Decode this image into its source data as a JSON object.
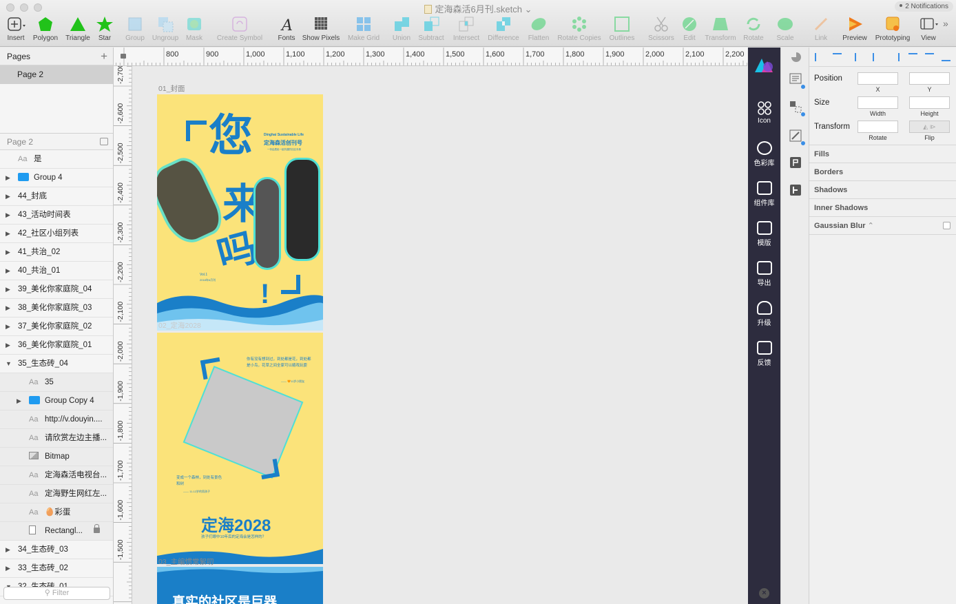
{
  "window": {
    "title": "定海森活6月刊.sketch",
    "notifications": "2 Notifications"
  },
  "toolbar": {
    "items": [
      {
        "label": "Insert",
        "icon": "insert-plus-icon"
      },
      {
        "label": "Polygon",
        "icon": "polygon-icon"
      },
      {
        "label": "Triangle",
        "icon": "triangle-icon"
      },
      {
        "label": "Star",
        "icon": "star-icon"
      },
      {
        "label": "Group",
        "icon": "group-icon"
      },
      {
        "label": "Ungroup",
        "icon": "ungroup-icon"
      },
      {
        "label": "Mask",
        "icon": "mask-icon"
      },
      {
        "label": "Create Symbol",
        "icon": "create-symbol-icon"
      },
      {
        "label": "Fonts",
        "icon": "fonts-icon"
      },
      {
        "label": "Show Pixels",
        "icon": "show-pixels-icon"
      },
      {
        "label": "Make Grid",
        "icon": "make-grid-icon"
      },
      {
        "label": "Union",
        "icon": "union-icon"
      },
      {
        "label": "Subtract",
        "icon": "subtract-icon"
      },
      {
        "label": "Intersect",
        "icon": "intersect-icon"
      },
      {
        "label": "Difference",
        "icon": "difference-icon"
      },
      {
        "label": "Flatten",
        "icon": "flatten-icon"
      },
      {
        "label": "Rotate Copies",
        "icon": "rotate-copies-icon"
      },
      {
        "label": "Outlines",
        "icon": "outlines-icon"
      },
      {
        "label": "Scissors",
        "icon": "scissors-icon"
      },
      {
        "label": "Edit",
        "icon": "edit-icon"
      },
      {
        "label": "Transform",
        "icon": "transform-icon"
      },
      {
        "label": "Rotate",
        "icon": "rotate-icon"
      },
      {
        "label": "Scale",
        "icon": "scale-icon"
      },
      {
        "label": "Link",
        "icon": "link-icon"
      },
      {
        "label": "Preview",
        "icon": "preview-icon"
      },
      {
        "label": "Prototyping",
        "icon": "prototyping-icon"
      },
      {
        "label": "View",
        "icon": "view-icon"
      }
    ]
  },
  "sidebar": {
    "pages_title": "Pages",
    "current_page": "Page 2",
    "layers_title": "Page 2",
    "filter_placeholder": "Filter",
    "layers": [
      {
        "name": "是",
        "kind": "text",
        "level": 0
      },
      {
        "name": "Group 4",
        "kind": "group",
        "level": 0
      },
      {
        "name": "44_封底",
        "kind": "artboard",
        "level": 0
      },
      {
        "name": "43_活动时间表",
        "kind": "artboard",
        "level": 0
      },
      {
        "name": "42_社区小组列表",
        "kind": "artboard",
        "level": 0
      },
      {
        "name": "41_共治_02",
        "kind": "artboard",
        "level": 0
      },
      {
        "name": "40_共治_01",
        "kind": "artboard",
        "level": 0
      },
      {
        "name": "39_美化你家庭院_04",
        "kind": "artboard",
        "level": 0
      },
      {
        "name": "38_美化你家庭院_03",
        "kind": "artboard",
        "level": 0
      },
      {
        "name": "37_美化你家庭院_02",
        "kind": "artboard",
        "level": 0
      },
      {
        "name": "36_美化你家庭院_01",
        "kind": "artboard",
        "level": 0
      },
      {
        "name": "35_生态砖_04",
        "kind": "artboard-open",
        "level": 0
      },
      {
        "name": "35",
        "kind": "text",
        "level": 1
      },
      {
        "name": "Group Copy 4",
        "kind": "group",
        "level": 1
      },
      {
        "name": "http://v.douyin....",
        "kind": "text",
        "level": 1
      },
      {
        "name": "请欣赏左边主播...",
        "kind": "text",
        "level": 1
      },
      {
        "name": "Bitmap",
        "kind": "bitmap",
        "level": 1
      },
      {
        "name": "定海森活电视台...",
        "kind": "text",
        "level": 1
      },
      {
        "name": "定海野生网红左...",
        "kind": "text",
        "level": 1
      },
      {
        "name": "🥚彩蛋",
        "kind": "text",
        "level": 1
      },
      {
        "name": "Rectangl...",
        "kind": "rect-locked",
        "level": 1
      },
      {
        "name": "34_生态砖_03",
        "kind": "artboard",
        "level": 0
      },
      {
        "name": "33_生态砖_02",
        "kind": "artboard",
        "level": 0
      },
      {
        "name": "32_生态砖_01",
        "kind": "artboard-open",
        "level": 0
      }
    ]
  },
  "rulers": {
    "top": [
      "800",
      "900",
      "1,000",
      "1,100",
      "1,200",
      "1,300",
      "1,400",
      "1,500",
      "1,600",
      "1,700",
      "1,800",
      "1,900",
      "2,000",
      "2,100",
      "2,200"
    ],
    "left": [
      "-2,700",
      "-2,600",
      "-2,500",
      "-2,400",
      "-2,300",
      "-2,200",
      "-2,100",
      "-2,000",
      "-1,900",
      "-1,800",
      "-1,700",
      "-1,600",
      "-1,500"
    ]
  },
  "canvas": {
    "artboards": [
      {
        "label": "01_封面"
      },
      {
        "label": "02_定海2028"
      },
      {
        "label": "03_主编惯常絮叨"
      }
    ],
    "cover": {
      "subtitle_en": "Dinghai Sustainable Life",
      "title_cn": "定海森活创刊号",
      "tagline": "一份由居民一起共建的社区手册",
      "headline_chars": [
        "您",
        "来",
        "吗",
        "!"
      ],
      "vol": "Vol.1",
      "date": "2018年6月刊"
    },
    "page2": {
      "quote_top": "你有没有想到过，到处都是花，到处都是小鸟，花草之间全家可以嬉戏玩耍",
      "quote_top_author": "—— 🧡11岁小朋友",
      "quote_bottom": "变成一个森林，到处有景色和树",
      "quote_bottom_author": "—— 11-12岁的男孩子",
      "headline": "定海2028",
      "subline": "孩子们眼中10年后的定海会是怎样的？"
    },
    "page3": {
      "headline": "真实的社区是巨器"
    }
  },
  "plugin_panel": {
    "items": [
      {
        "label": "Icon",
        "icon": "icon-grid-icon"
      },
      {
        "label": "色彩库",
        "icon": "palette-icon"
      },
      {
        "label": "组件库",
        "icon": "components-icon"
      },
      {
        "label": "模版",
        "icon": "template-icon"
      },
      {
        "label": "导出",
        "icon": "export-terminal-icon"
      },
      {
        "label": "升级",
        "icon": "upgrade-cloud-icon"
      },
      {
        "label": "反馈",
        "icon": "feedback-chat-icon"
      }
    ]
  },
  "inspector": {
    "position_label": "Position",
    "x_label": "X",
    "y_label": "Y",
    "size_label": "Size",
    "width_label": "Width",
    "height_label": "Height",
    "transform_label": "Transform",
    "rotate_label": "Rotate",
    "flip_label": "Flip",
    "sections": [
      "Fills",
      "Borders",
      "Shadows",
      "Inner Shadows",
      "Gaussian Blur"
    ]
  },
  "colors": {
    "artboard_yellow": "#fbe37a",
    "brand_blue": "#1a7fc8",
    "accent_teal": "#4fe0d4",
    "plugin_dark": "#2d2c3e"
  }
}
